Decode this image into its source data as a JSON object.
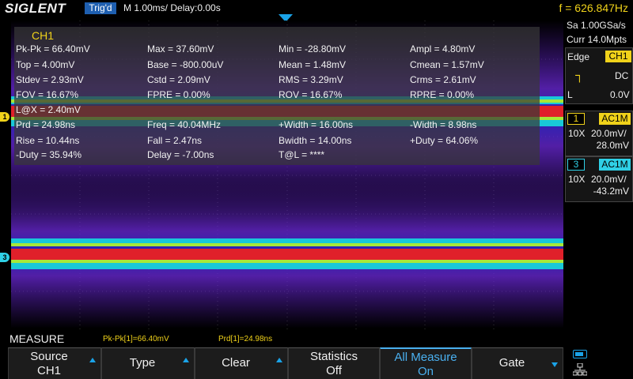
{
  "topbar": {
    "logo": "SIGLENT",
    "trigger_status": "Trig'd",
    "timebase": "M 1.00ms/ Delay:0.00s",
    "frequency": "f = 626.847Hz"
  },
  "measure_panel": {
    "channel": "CH1",
    "rows": [
      [
        "Pk-Pk = 66.40mV",
        "Max = 37.60mV",
        "Min = -28.80mV",
        "Ampl = 4.80mV"
      ],
      [
        "Top = 4.00mV",
        "Base = -800.00uV",
        "Mean = 1.48mV",
        "Cmean = 1.57mV"
      ],
      [
        "Stdev = 2.93mV",
        "Cstd = 2.09mV",
        "RMS = 3.29mV",
        "Crms = 2.61mV"
      ],
      [
        "FOV = 16.67%",
        "FPRE = 0.00%",
        "ROV = 16.67%",
        "RPRE = 0.00%"
      ],
      [
        "L@X = 2.40mV",
        "",
        "",
        ""
      ],
      [
        "Prd = 24.98ns",
        "Freq = 40.04MHz",
        "+Width = 16.00ns",
        "-Width = 8.98ns"
      ],
      [
        "Rise = 10.44ns",
        "Fall = 2.47ns",
        "Bwidth = 14.00ns",
        "+Duty = 64.06%"
      ],
      [
        "-Duty = 35.94%",
        "Delay = -7.00ns",
        "T@L = ****",
        ""
      ]
    ]
  },
  "channel_markers": {
    "ch1": "1",
    "ch3": "3"
  },
  "right_panel": {
    "sample_rate": "Sa 1.00GSa/s",
    "memory_depth": "Curr 14.0Mpts",
    "trigger": {
      "type": "Edge",
      "source": "CH1",
      "coupling": "DC",
      "level_label": "L",
      "level": "0.0V"
    },
    "ch1": {
      "number": "1",
      "coupling": "AC1M",
      "probe": "10X",
      "scale": "20.0mV/",
      "offset": "28.0mV"
    },
    "ch3": {
      "number": "3",
      "coupling": "AC1M",
      "probe": "10X",
      "scale": "20.0mV/",
      "offset": "-43.2mV"
    }
  },
  "bottom": {
    "menu_title": "MEASURE",
    "stat1": "Pk-Pk[1]=66.40mV",
    "stat2": "Prd[1]=24.98ns",
    "softkeys": [
      {
        "line1": "Source",
        "line2": "CH1"
      },
      {
        "line1": "Type",
        "line2": ""
      },
      {
        "line1": "Clear",
        "line2": ""
      },
      {
        "line1": "Statistics",
        "line2": "Off"
      },
      {
        "line1": "All Measure",
        "line2": "On"
      },
      {
        "line1": "Gate",
        "line2": ""
      }
    ]
  },
  "colors": {
    "ch1": "#f0d21a",
    "ch3": "#2fd0e6",
    "accent": "#1aa3e8",
    "trace_hot": "#e0202a",
    "trace_glow": "#7b2ee8"
  }
}
